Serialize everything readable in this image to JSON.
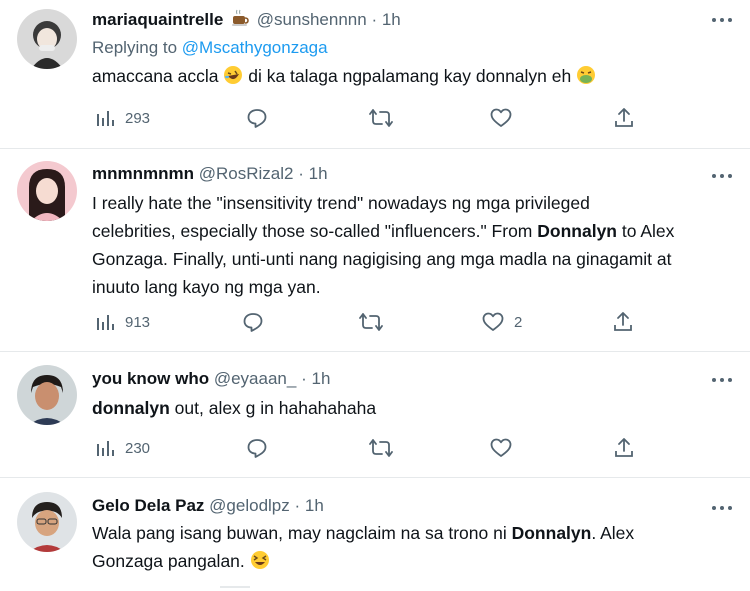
{
  "tweets": [
    {
      "name": "mariaquaintrelle",
      "name_emoji": "coffee-emoji",
      "handle": "@sunshennnn",
      "sep": "·",
      "time": "1h",
      "reply_prefix": "Replying to",
      "reply_handle": "@Mscathygonzaga",
      "text_parts": [
        "amaccana accla",
        "di ka talaga ngpalamang kay donnalyn eh"
      ],
      "views": "293",
      "likes": ""
    },
    {
      "name": "mnmnmnmn",
      "handle": "@RosRizal2",
      "sep": "·",
      "time": "1h",
      "text_parts": [
        "I really hate the \"insensitivity trend\" nowadays ng mga privileged",
        "celebrities, especially those so-called \"influencers.\" From",
        "Donnalyn",
        "to Alex",
        "Gonzaga. Finally, unti-unti nang nagigising ang mga madla na ginagamit at",
        "inuuto lang kayo ng mga yan."
      ],
      "views": "913",
      "likes": "2"
    },
    {
      "name": "you know who",
      "handle": "@eyaaan_",
      "sep": "·",
      "time": "1h",
      "text_parts": [
        "donnalyn",
        "out, alex g in hahahahaha"
      ],
      "views": "230",
      "likes": ""
    },
    {
      "name": "Gelo Dela Paz",
      "handle": "@gelodlpz",
      "sep": "·",
      "time": "1h",
      "text_parts": [
        "Wala pang isang buwan, may nagclaim na sa trono ni",
        "Donnalyn",
        ". Alex",
        "Gonzaga pangalan."
      ],
      "views": "",
      "likes": ""
    }
  ],
  "icons": {
    "views": "bar-chart-icon",
    "reply": "speech-bubble-icon",
    "retweet": "retweet-icon",
    "like": "heart-icon",
    "share": "share-upload-icon",
    "more": "more-dots-icon"
  },
  "colors": {
    "text": "#0f1419",
    "muted": "#536471",
    "link": "#1d9bf0",
    "divider": "#e6e9eb"
  }
}
